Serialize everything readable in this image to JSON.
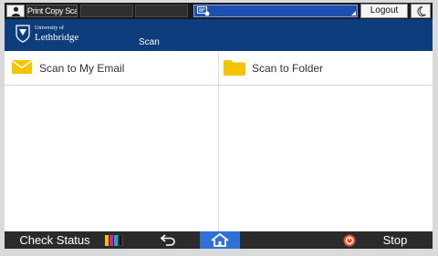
{
  "topbar": {
    "user_icon": "user-icon",
    "user_name": "Print Copy Scan",
    "status_icon": "message-list-icon",
    "logout_label": "Logout",
    "mode_icon": "moon-icon"
  },
  "header": {
    "logo_line1": "University of",
    "logo_line2": "Lethbridge",
    "title": "Scan"
  },
  "shortcuts": [
    {
      "label": "Scan to My Email",
      "icon": "envelope-icon",
      "color": "#f5c400"
    },
    {
      "label": "Scan to Folder",
      "icon": "folder-icon",
      "color": "#f5c400"
    }
  ],
  "bottombar": {
    "check_status_label": "Check Status",
    "toner_icon": "toner-icon",
    "back_icon": "back-arrow-icon",
    "home_icon": "home-icon",
    "energy_icon": "energy-saver-icon",
    "stop_label": "Stop"
  },
  "colors": {
    "header_blue": "#0d3d7c",
    "status_blue": "#1d4fb0",
    "home_blue": "#2f6fd6",
    "bar_dark": "#2b2b2b",
    "accent_yellow": "#f5c400"
  }
}
